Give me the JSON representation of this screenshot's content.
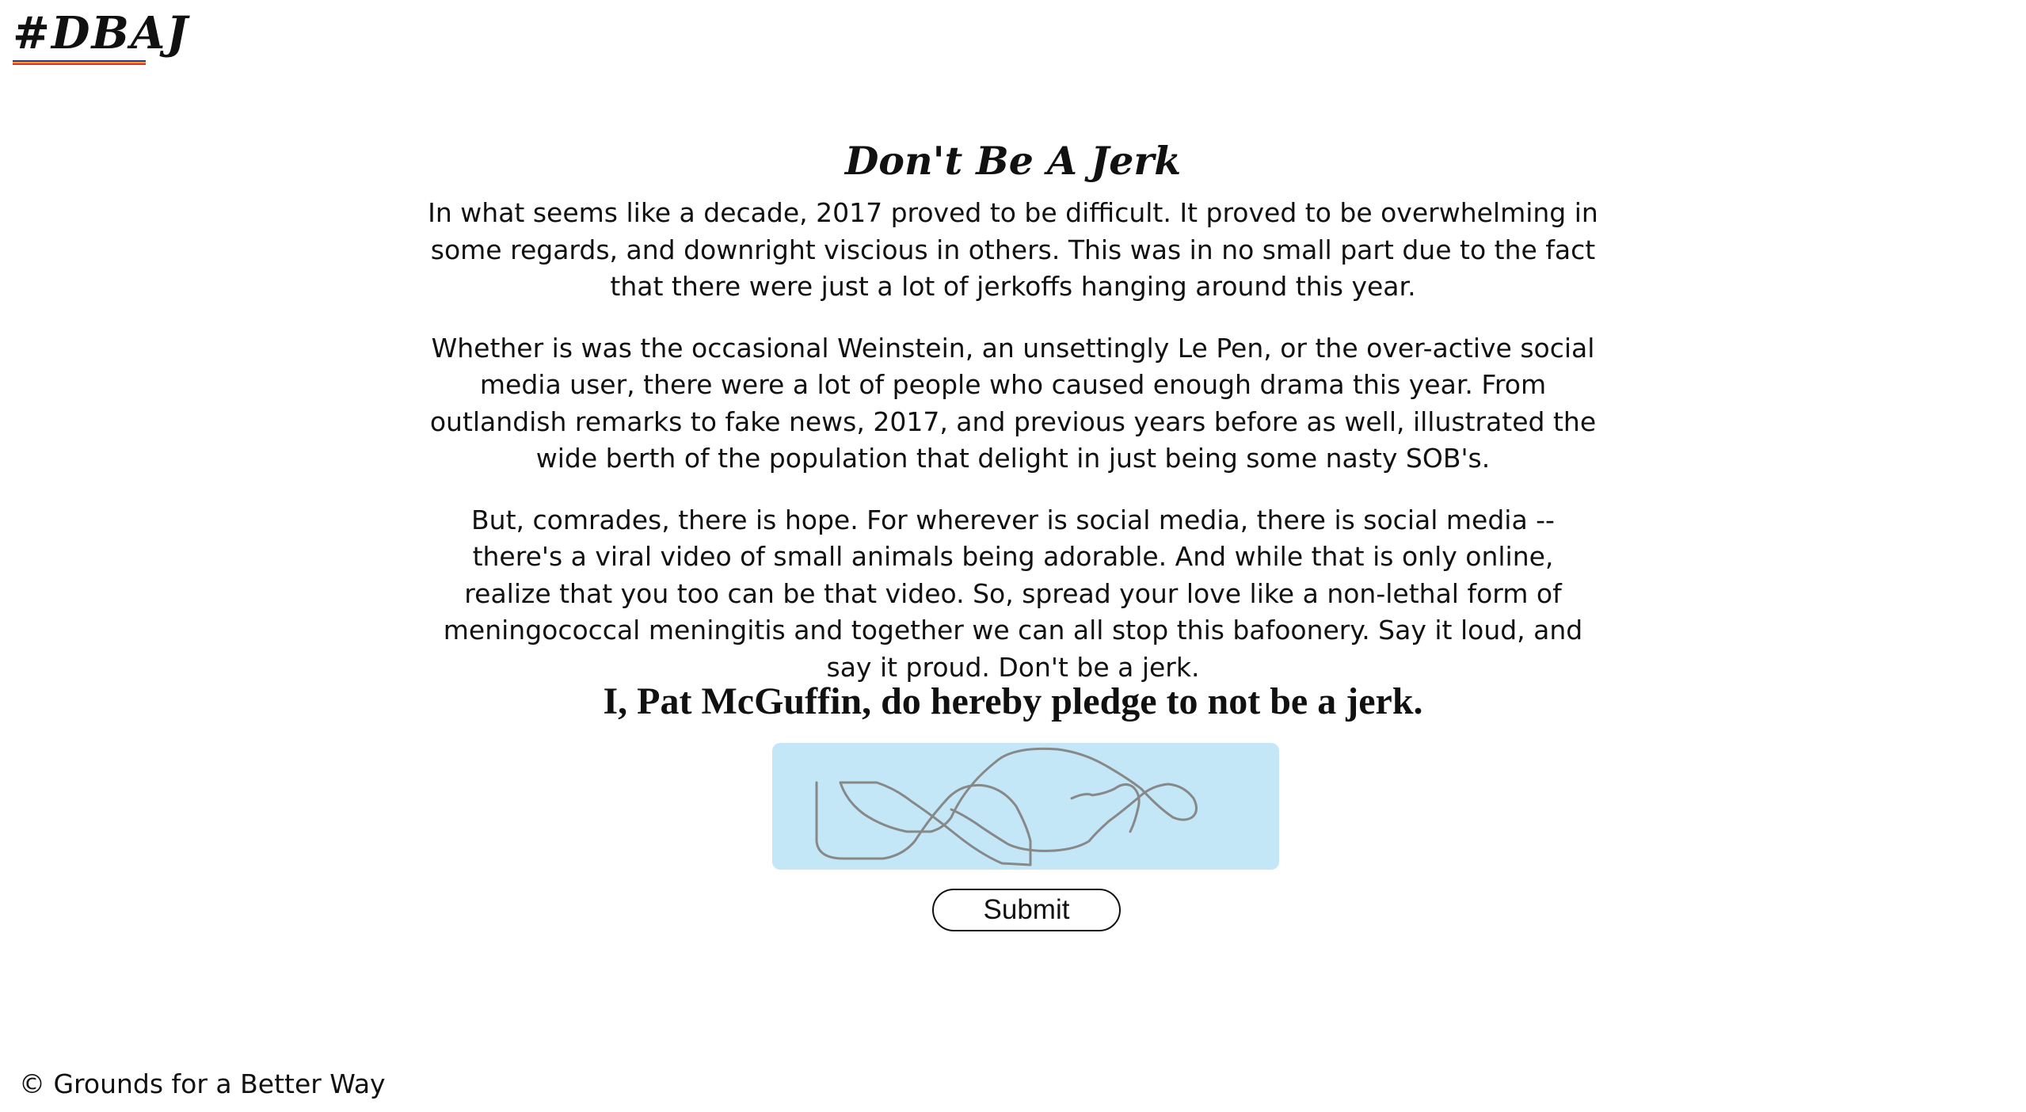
{
  "header": {
    "logo_text": "#DBAJ",
    "logo_underline_colors": [
      "#2c3e8f",
      "#f0a030",
      "#d9342b"
    ]
  },
  "main": {
    "title": "Don't Be A Jerk",
    "paragraphs": [
      "In what seems like a decade, 2017 proved to be difficult. It proved to be overwhelming in some regards, and downright viscious in others. This was in no small part due to the fact that there were just a lot of jerkoffs hanging around this year.",
      "Whether is was the occasional Weinstein, an unsettingly Le Pen, or the over-active social media user, there were a lot of people who caused enough drama this year. From outlandish remarks to fake news, 2017, and previous years before as well, illustrated the wide berth of the population that delight in just being some nasty SOB's.",
      "But, comrades, there is hope. For wherever is social media, there is social media -- there's a viral video of small animals being adorable. And while that is only online, realize that you too can be that video. So, spread your love like a non-lethal form of meningococcal meningitis and together we can all stop this bafoonery. Say it loud, and say it proud. Don't be a jerk."
    ],
    "pledge_text": "I, Pat McGuffin, do hereby pledge to not be a jerk.",
    "signature_pad": {
      "background_color": "#c3e7f6",
      "stroke_color": "#888888"
    },
    "submit_label": "Submit"
  },
  "footer": {
    "copyright": "© Grounds for a Better Way"
  }
}
